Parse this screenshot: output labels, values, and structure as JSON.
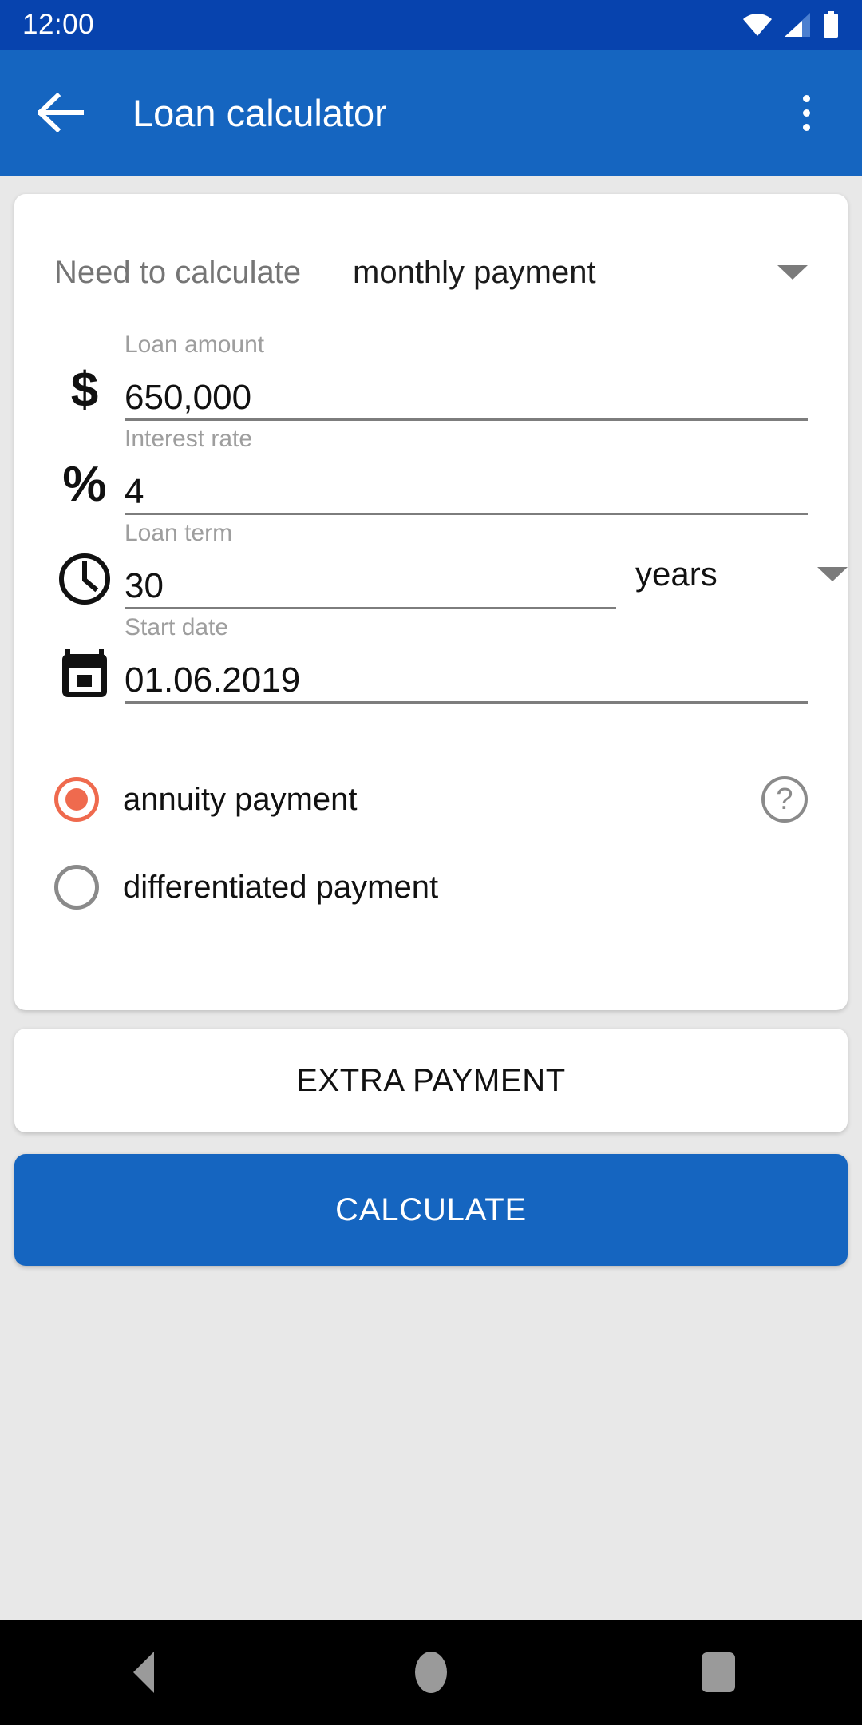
{
  "status_bar": {
    "time": "12:00",
    "icons": [
      "wifi-icon",
      "cellular-signal-icon",
      "battery-icon"
    ],
    "background": "#0743AE"
  },
  "app_bar": {
    "title": "Loan calculator",
    "back_icon": "back-arrow-icon",
    "overflow_icon": "overflow-menu-icon",
    "background": "#1565C0"
  },
  "form": {
    "need_to_calculate": {
      "label": "Need to calculate",
      "value": "monthly payment",
      "caret_icon": "chevron-down-icon"
    },
    "loan_amount": {
      "label": "Loan amount",
      "value": "650,000",
      "icon": "dollar-icon",
      "icon_glyph": "$"
    },
    "interest_rate": {
      "label": "Interest rate",
      "value": "4",
      "icon": "percent-icon",
      "icon_glyph": "%"
    },
    "loan_term": {
      "label": "Loan term",
      "value": "30",
      "icon": "clock-icon",
      "unit": "years",
      "unit_caret_icon": "chevron-down-icon"
    },
    "start_date": {
      "label": "Start date",
      "value": "01.06.2019",
      "icon": "calendar-icon"
    },
    "payment_type": {
      "selected": "annuity payment",
      "options": [
        {
          "label": "annuity payment",
          "selected": true
        },
        {
          "label": "differentiated payment",
          "selected": false
        }
      ],
      "help_icon": "help-circle-icon",
      "help_glyph": "?",
      "selected_color": "#EF6A4E"
    }
  },
  "actions": {
    "extra_payment_label": "EXTRA PAYMENT",
    "calculate_label": "CALCULATE",
    "calculate_color": "#1565C0"
  },
  "nav_bar": {
    "back_icon": "nav-back-triangle-icon",
    "home_icon": "nav-home-circle-icon",
    "recents_icon": "nav-recents-square-icon"
  }
}
